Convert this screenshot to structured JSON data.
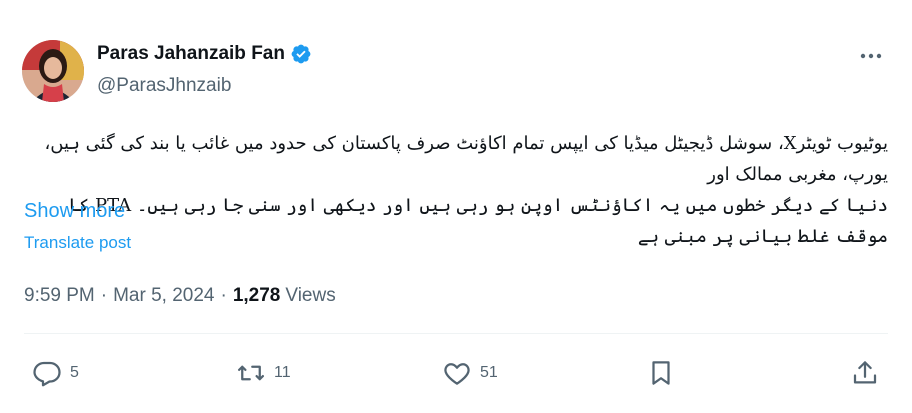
{
  "author": {
    "display_name": "Paras Jahanzaib Fan",
    "handle": "@ParasJhnzaib",
    "verified_icon": "verified-badge-icon",
    "avatar_icon": "avatar"
  },
  "tweet": {
    "line1": "یوٹیوب ٹویٹرX، سوشل ڈیجیٹل میڈیا کی ایپس تمام اکاؤنٹ صرف پاکستان کی حدود میں غائب یا بند کی گئی ہیں، یورپ، مغربی ممالک اور",
    "line2": "دنیا کے دیگر خطوں میں یہ اکاؤنٹس اوپن ہو رہی ہیں اور دیکھی اور سنی جا رہی ہیں۔ PTA کا موقف غلط بیانی پر مبنی ہے",
    "show_more": "Show more",
    "translate": "Translate post"
  },
  "meta": {
    "time": "9:59 PM",
    "date": "Mar 5, 2024",
    "views_count": "1,278",
    "views_label": "Views",
    "separator": "·"
  },
  "actions": {
    "reply_count": "5",
    "retweet_count": "11",
    "like_count": "51"
  },
  "colors": {
    "accent": "#1d9bf0",
    "secondary_text": "#536471",
    "primary_text": "#0f1419"
  }
}
